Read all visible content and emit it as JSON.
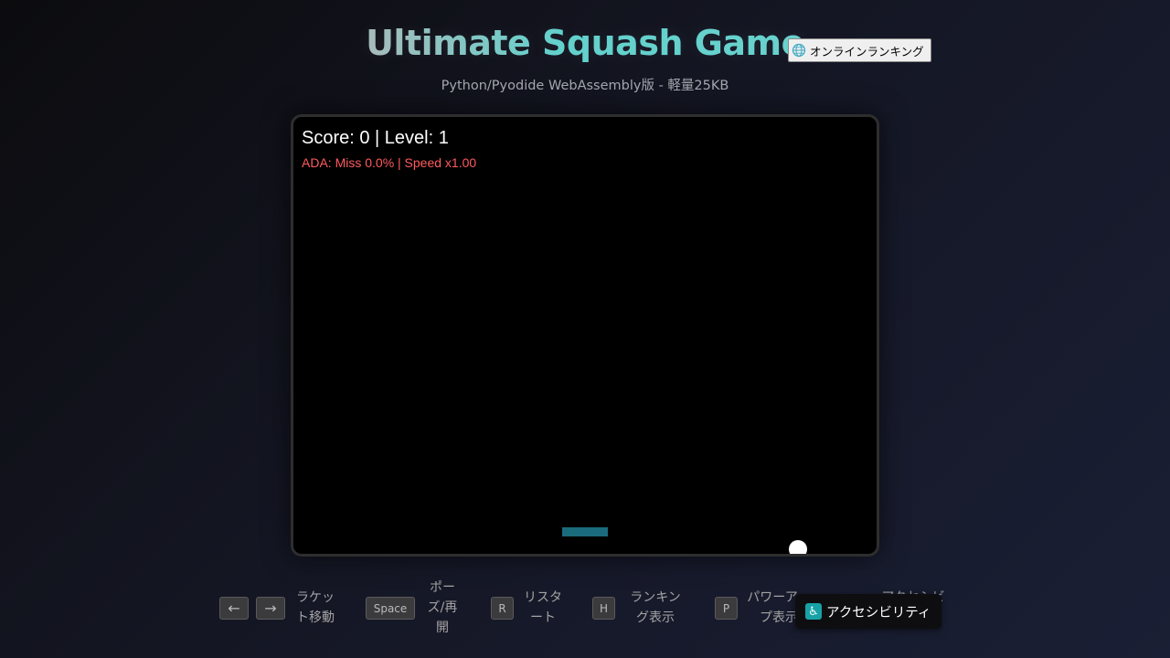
{
  "header": {
    "title": "Ultimate Squash Game",
    "subtitle": "Python/Pyodide WebAssembly版 - 軽量25KB",
    "ranking_button": "オンラインランキング"
  },
  "game": {
    "score_line": "Score: 0 | Level: 1",
    "ada_line": "ADA: Miss 0.0% | Speed x1.00"
  },
  "controls": [
    {
      "keys": [
        "←",
        "→"
      ],
      "label": "ラケット移動"
    },
    {
      "keys": [
        "Space"
      ],
      "label": "ポーズ/再開"
    },
    {
      "keys": [
        "R"
      ],
      "label": "リスタート"
    },
    {
      "keys": [
        "H"
      ],
      "label": "ランキング表示"
    },
    {
      "keys": [
        "P"
      ],
      "label": "パワーアップ表示"
    },
    {
      "keys": [
        ""
      ],
      "label": "アクセシビリティ"
    }
  ],
  "accessibility_button": "アクセシビリティ",
  "colors": {
    "paddle": "#1a6b7c",
    "ball": "#ffffff",
    "ada_text": "#ff5a5f",
    "title_accent": "#5fd0cb"
  },
  "icons": {
    "ranking": "globe-icon",
    "accessibility": "wheelchair-icon"
  }
}
